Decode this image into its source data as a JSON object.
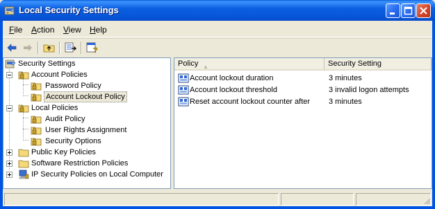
{
  "window": {
    "title": "Local Security Settings",
    "controls": {
      "minimize": "minimize",
      "maximize": "maximize",
      "close": "close"
    }
  },
  "menu": {
    "file": {
      "u": "F",
      "rest": "ile"
    },
    "action": {
      "u": "A",
      "rest": "ction"
    },
    "view": {
      "u": "V",
      "rest": "iew"
    },
    "help": {
      "u": "H",
      "rest": "elp"
    }
  },
  "toolbar": {
    "icons": [
      "back-arrow-icon",
      "forward-arrow-icon",
      "up-folder-icon",
      "export-list-icon",
      "help-icon"
    ]
  },
  "tree": {
    "root": "Security Settings",
    "account_policies": "Account Policies",
    "password_policy": "Password Policy",
    "account_lockout_policy": "Account Lockout Policy",
    "local_policies": "Local Policies",
    "audit_policy": "Audit Policy",
    "user_rights_assignment": "User Rights Assignment",
    "security_options": "Security Options",
    "public_key_policies": "Public Key Policies",
    "software_restriction_policies": "Software Restriction Policies",
    "ip_security_policies": "IP Security Policies on Local Computer",
    "selected": "Account Lockout Policy"
  },
  "list": {
    "columns": {
      "policy": "Policy",
      "setting": "Security Setting"
    },
    "rows": [
      {
        "policy": "Account lockout duration",
        "setting": "3 minutes"
      },
      {
        "policy": "Account lockout threshold",
        "setting": "3 invalid logon attempts"
      },
      {
        "policy": "Reset account lockout counter after",
        "setting": "3 minutes"
      }
    ]
  },
  "colors": {
    "titlebar": "#0054e3",
    "selection": "#ece9d8",
    "folder": "#f5d878"
  }
}
